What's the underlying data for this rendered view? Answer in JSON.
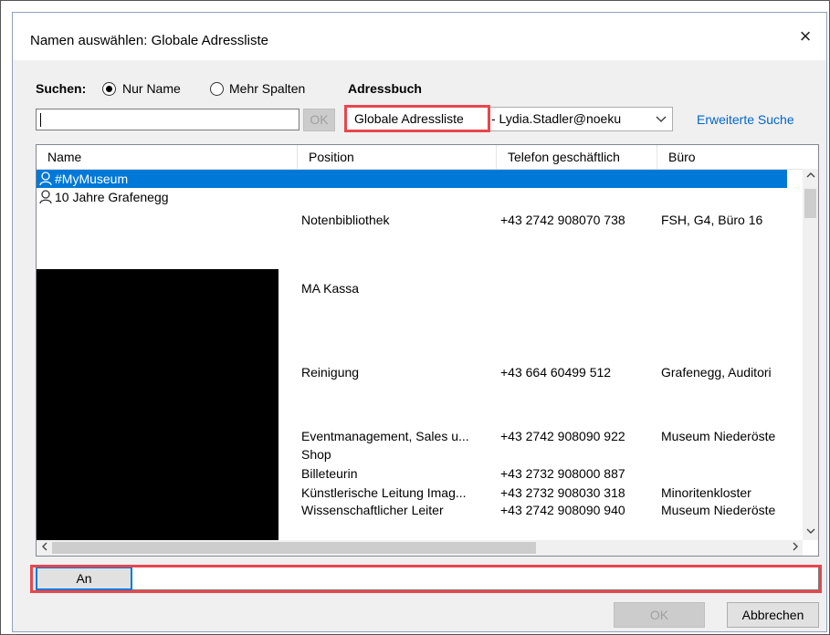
{
  "window": {
    "title": "Namen auswählen: Globale Adressliste",
    "close_glyph": "×"
  },
  "search": {
    "label": "Suchen:",
    "option_name": "Nur Name",
    "option_columns": "Mehr Spalten",
    "selected_option": "Nur Name",
    "input_value": "",
    "ok_label": "OK"
  },
  "addressbook": {
    "label": "Adressbuch",
    "selected": "Globale Adressliste",
    "account": "- Lydia.Stadler@noeku",
    "advanced_search": "Erweiterte Suche"
  },
  "table": {
    "columns": [
      "Name",
      "Position",
      "Telefon geschäftlich",
      "Büro"
    ],
    "rows": [
      {
        "name": "#MyMuseum",
        "position": "",
        "phone": "",
        "office": "",
        "selected": true
      },
      {
        "name": "10 Jahre Grafenegg",
        "position": "",
        "phone": "",
        "office": ""
      },
      {
        "name": "",
        "position": "Notenbibliothek",
        "phone": "+43 2742 908070 738",
        "office": "FSH, G4, Büro 16"
      },
      {
        "name": "",
        "position": "MA Kassa",
        "phone": "",
        "office": ""
      },
      {
        "name": "",
        "position": "Reinigung",
        "phone": "+43 664 60499 512",
        "office": "Grafenegg, Auditori"
      },
      {
        "name": "",
        "position": "Eventmanagement, Sales u...",
        "phone": "+43 2742 908090 922",
        "office": "Museum Niederöste"
      },
      {
        "name": "",
        "position": "Shop",
        "phone": "",
        "office": ""
      },
      {
        "name": "",
        "position": "Billeteurin",
        "phone": "+43 2732 908000 887",
        "office": ""
      },
      {
        "name": "",
        "position": "Künstlerische Leitung Imag...",
        "phone": "+43 2732 908030 318",
        "office": "Minoritenkloster"
      },
      {
        "name": "",
        "position": "Wissenschaftlicher Leiter",
        "phone": "+43 2742 908090 940",
        "office": "Museum Niederöste"
      }
    ]
  },
  "recipients": {
    "to_label": "An",
    "to_value": ""
  },
  "footer": {
    "ok_label": "OK",
    "cancel_label": "Abbrechen"
  },
  "colors": {
    "selection": "#0078d7",
    "highlight_box": "#e8464e",
    "link": "#0066cc"
  }
}
